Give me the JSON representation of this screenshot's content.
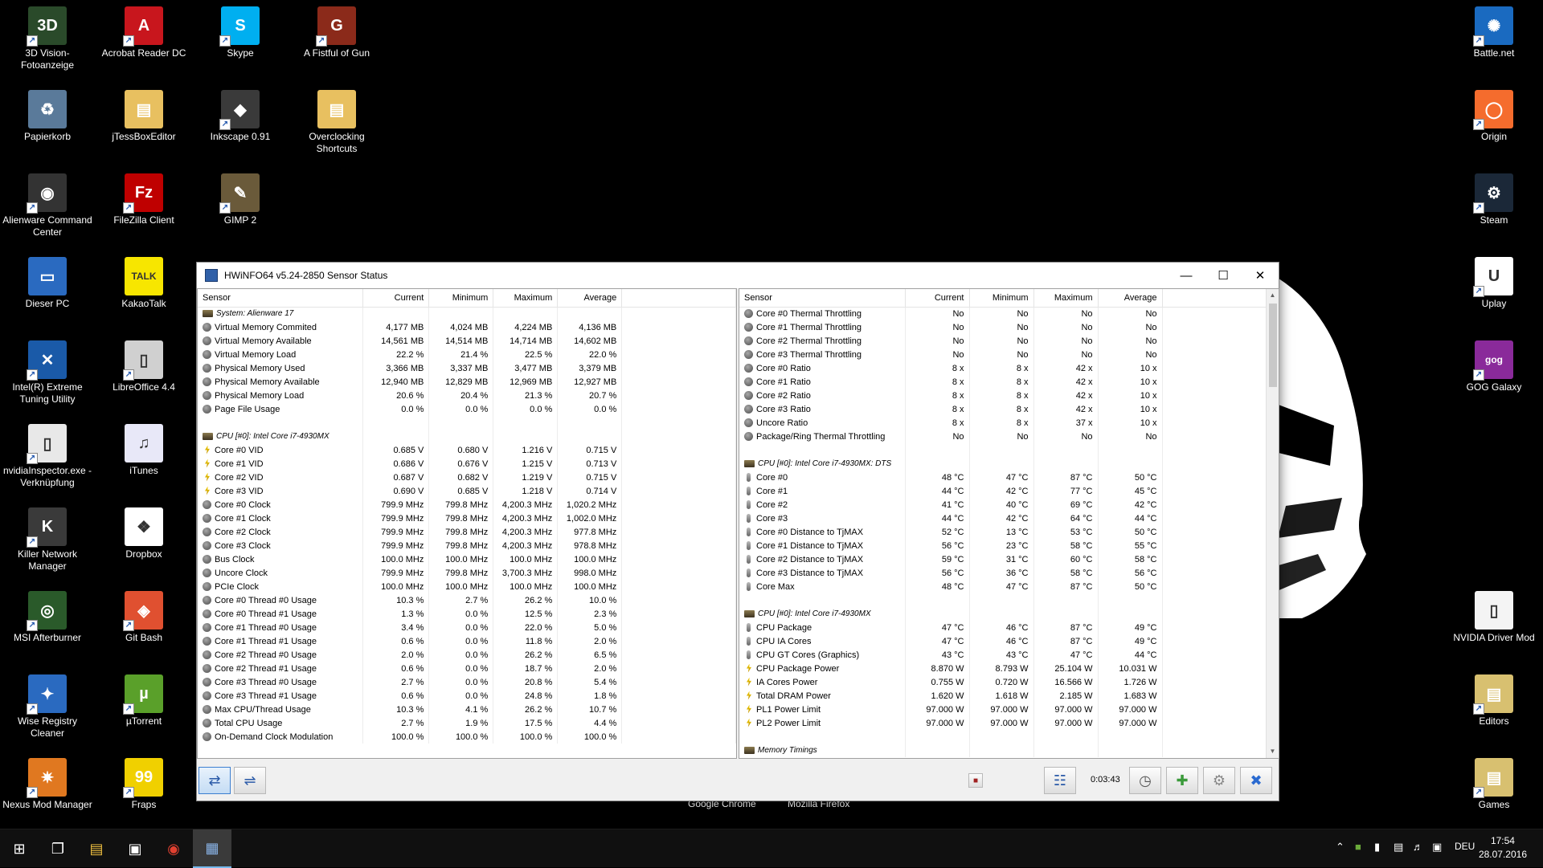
{
  "desktop_icons": [
    {
      "label": "3D Vision-Fotoanzeige",
      "bg": "#2a4a2a",
      "glyph": "3D",
      "shortcut": true
    },
    {
      "label": "Acrobat Reader DC",
      "bg": "#c8161d",
      "glyph": "A",
      "shortcut": true
    },
    {
      "label": "Skype",
      "bg": "#00aff0",
      "glyph": "S",
      "shortcut": true
    },
    {
      "label": "A Fistful of Gun",
      "bg": "#8b2a1a",
      "glyph": "G",
      "shortcut": true
    },
    {
      "label": "Papierkorb",
      "bg": "#5a7a9a",
      "glyph": "♻",
      "shortcut": false
    },
    {
      "label": "jTessBoxEditor",
      "bg": "#e8c060",
      "glyph": "▤",
      "shortcut": false
    },
    {
      "label": "Inkscape 0.91",
      "bg": "#3a3a3a",
      "glyph": "◆",
      "shortcut": true
    },
    {
      "label": "Overclocking Shortcuts",
      "bg": "#e8c060",
      "glyph": "▤",
      "shortcut": false
    },
    {
      "label": "Alienware Command Center",
      "bg": "#333",
      "glyph": "◉",
      "shortcut": true
    },
    {
      "label": "FileZilla Client",
      "bg": "#bf0000",
      "glyph": "Fz",
      "shortcut": true
    },
    {
      "label": "GIMP 2",
      "bg": "#6a5a3a",
      "glyph": "✎",
      "shortcut": true
    },
    {
      "label": "Dieser PC",
      "bg": "#2a6ac0",
      "glyph": "▭",
      "shortcut": false
    },
    {
      "label": "KakaoTalk",
      "bg": "#f7e600",
      "glyph": "TALK",
      "shortcut": false
    },
    {
      "label": "Intel(R) Extreme Tuning Utility",
      "bg": "#1a5aa8",
      "glyph": "✕",
      "shortcut": true
    },
    {
      "label": "LibreOffice 4.4",
      "bg": "#d0d0d0",
      "glyph": "▯",
      "shortcut": true
    },
    {
      "label": "nvidiaInspector.exe - Verknüpfung",
      "bg": "#e8e8e8",
      "glyph": "▯",
      "shortcut": true
    },
    {
      "label": "iTunes",
      "bg": "#e8e8f8",
      "glyph": "♫",
      "shortcut": false
    },
    {
      "label": "Killer Network Manager",
      "bg": "#3a3a3a",
      "glyph": "K",
      "shortcut": true
    },
    {
      "label": "Dropbox",
      "bg": "#ffffff",
      "glyph": "❖",
      "shortcut": false
    },
    {
      "label": "MSI Afterburner",
      "bg": "#2a5a2a",
      "glyph": "◎",
      "shortcut": true
    },
    {
      "label": "Git Bash",
      "bg": "#e05030",
      "glyph": "◈",
      "shortcut": true
    },
    {
      "label": "Wise Registry Cleaner",
      "bg": "#2a6ac0",
      "glyph": "✦",
      "shortcut": true
    },
    {
      "label": "µTorrent",
      "bg": "#5aa02a",
      "glyph": "µ",
      "shortcut": true
    },
    {
      "label": "Nexus Mod Manager",
      "bg": "#e07820",
      "glyph": "✷",
      "shortcut": true
    },
    {
      "label": "Fraps",
      "bg": "#f0d000",
      "glyph": "99",
      "shortcut": true
    },
    {
      "label": "Battle.net",
      "bg": "#1a6ac0",
      "glyph": "✺",
      "shortcut": true
    },
    {
      "label": "Origin",
      "bg": "#f56c2d",
      "glyph": "◯",
      "shortcut": true
    },
    {
      "label": "Steam",
      "bg": "#1b2838",
      "glyph": "⚙",
      "shortcut": true
    },
    {
      "label": "Uplay",
      "bg": "#ffffff",
      "glyph": "U",
      "shortcut": true
    },
    {
      "label": "GOG Galaxy",
      "bg": "#8a2a9a",
      "glyph": "gog",
      "shortcut": true
    },
    {
      "label": "NVIDIA Driver Mod",
      "bg": "#f4f4f4",
      "glyph": "▯",
      "shortcut": false
    },
    {
      "label": "Editors",
      "bg": "#d8c070",
      "glyph": "▤",
      "shortcut": true
    },
    {
      "label": "Games",
      "bg": "#d8c070",
      "glyph": "▤",
      "shortcut": true
    }
  ],
  "hidden_labels": [
    "Google Chrome",
    "Mozilla Firefox"
  ],
  "window": {
    "title": "HWiNFO64 v5.24-2850 Sensor Status",
    "timer": "0:03:43"
  },
  "columns": {
    "sensor": "Sensor",
    "current": "Current",
    "minimum": "Minimum",
    "maximum": "Maximum",
    "average": "Average"
  },
  "left_rows": [
    {
      "type": "group",
      "name": "System: Alienware 17"
    },
    {
      "icon": "circle",
      "name": "Virtual Memory Commited",
      "cur": "4,177 MB",
      "min": "4,024 MB",
      "max": "4,224 MB",
      "avg": "4,136 MB"
    },
    {
      "icon": "circle",
      "name": "Virtual Memory Available",
      "cur": "14,561 MB",
      "min": "14,514 MB",
      "max": "14,714 MB",
      "avg": "14,602 MB"
    },
    {
      "icon": "circle",
      "name": "Virtual Memory Load",
      "cur": "22.2 %",
      "min": "21.4 %",
      "max": "22.5 %",
      "avg": "22.0 %"
    },
    {
      "icon": "circle",
      "name": "Physical Memory Used",
      "cur": "3,366 MB",
      "min": "3,337 MB",
      "max": "3,477 MB",
      "avg": "3,379 MB"
    },
    {
      "icon": "circle",
      "name": "Physical Memory Available",
      "cur": "12,940 MB",
      "min": "12,829 MB",
      "max": "12,969 MB",
      "avg": "12,927 MB"
    },
    {
      "icon": "circle",
      "name": "Physical Memory Load",
      "cur": "20.6 %",
      "min": "20.4 %",
      "max": "21.3 %",
      "avg": "20.7 %"
    },
    {
      "icon": "circle",
      "name": "Page File Usage",
      "cur": "0.0 %",
      "min": "0.0 %",
      "max": "0.0 %",
      "avg": "0.0 %"
    },
    {
      "type": "blank"
    },
    {
      "type": "group",
      "name": "CPU [#0]: Intel Core i7-4930MX"
    },
    {
      "icon": "volt",
      "name": "Core #0 VID",
      "cur": "0.685 V",
      "min": "0.680 V",
      "max": "1.216 V",
      "avg": "0.715 V"
    },
    {
      "icon": "volt",
      "name": "Core #1 VID",
      "cur": "0.686 V",
      "min": "0.676 V",
      "max": "1.215 V",
      "avg": "0.713 V"
    },
    {
      "icon": "volt",
      "name": "Core #2 VID",
      "cur": "0.687 V",
      "min": "0.682 V",
      "max": "1.219 V",
      "avg": "0.715 V"
    },
    {
      "icon": "volt",
      "name": "Core #3 VID",
      "cur": "0.690 V",
      "min": "0.685 V",
      "max": "1.218 V",
      "avg": "0.714 V"
    },
    {
      "icon": "circle",
      "name": "Core #0 Clock",
      "cur": "799.9 MHz",
      "min": "799.8 MHz",
      "max": "4,200.3 MHz",
      "avg": "1,020.2 MHz"
    },
    {
      "icon": "circle",
      "name": "Core #1 Clock",
      "cur": "799.9 MHz",
      "min": "799.8 MHz",
      "max": "4,200.3 MHz",
      "avg": "1,002.0 MHz"
    },
    {
      "icon": "circle",
      "name": "Core #2 Clock",
      "cur": "799.9 MHz",
      "min": "799.8 MHz",
      "max": "4,200.3 MHz",
      "avg": "977.8 MHz"
    },
    {
      "icon": "circle",
      "name": "Core #3 Clock",
      "cur": "799.9 MHz",
      "min": "799.8 MHz",
      "max": "4,200.3 MHz",
      "avg": "978.8 MHz"
    },
    {
      "icon": "circle",
      "name": "Bus Clock",
      "cur": "100.0 MHz",
      "min": "100.0 MHz",
      "max": "100.0 MHz",
      "avg": "100.0 MHz"
    },
    {
      "icon": "circle",
      "name": "Uncore Clock",
      "cur": "799.9 MHz",
      "min": "799.8 MHz",
      "max": "3,700.3 MHz",
      "avg": "998.0 MHz"
    },
    {
      "icon": "circle",
      "name": "PCIe Clock",
      "cur": "100.0 MHz",
      "min": "100.0 MHz",
      "max": "100.0 MHz",
      "avg": "100.0 MHz"
    },
    {
      "icon": "circle",
      "name": "Core #0 Thread #0 Usage",
      "cur": "10.3 %",
      "min": "2.7 %",
      "max": "26.2 %",
      "avg": "10.0 %"
    },
    {
      "icon": "circle",
      "name": "Core #0 Thread #1 Usage",
      "cur": "1.3 %",
      "min": "0.0 %",
      "max": "12.5 %",
      "avg": "2.3 %"
    },
    {
      "icon": "circle",
      "name": "Core #1 Thread #0 Usage",
      "cur": "3.4 %",
      "min": "0.0 %",
      "max": "22.0 %",
      "avg": "5.0 %"
    },
    {
      "icon": "circle",
      "name": "Core #1 Thread #1 Usage",
      "cur": "0.6 %",
      "min": "0.0 %",
      "max": "11.8 %",
      "avg": "2.0 %"
    },
    {
      "icon": "circle",
      "name": "Core #2 Thread #0 Usage",
      "cur": "2.0 %",
      "min": "0.0 %",
      "max": "26.2 %",
      "avg": "6.5 %"
    },
    {
      "icon": "circle",
      "name": "Core #2 Thread #1 Usage",
      "cur": "0.6 %",
      "min": "0.0 %",
      "max": "18.7 %",
      "avg": "2.0 %"
    },
    {
      "icon": "circle",
      "name": "Core #3 Thread #0 Usage",
      "cur": "2.7 %",
      "min": "0.0 %",
      "max": "20.8 %",
      "avg": "5.4 %"
    },
    {
      "icon": "circle",
      "name": "Core #3 Thread #1 Usage",
      "cur": "0.6 %",
      "min": "0.0 %",
      "max": "24.8 %",
      "avg": "1.8 %"
    },
    {
      "icon": "circle",
      "name": "Max CPU/Thread Usage",
      "cur": "10.3 %",
      "min": "4.1 %",
      "max": "26.2 %",
      "avg": "10.7 %"
    },
    {
      "icon": "circle",
      "name": "Total CPU Usage",
      "cur": "2.7 %",
      "min": "1.9 %",
      "max": "17.5 %",
      "avg": "4.4 %"
    },
    {
      "icon": "circle",
      "name": "On-Demand Clock Modulation",
      "cur": "100.0 %",
      "min": "100.0 %",
      "max": "100.0 %",
      "avg": "100.0 %"
    }
  ],
  "right_rows": [
    {
      "icon": "circle",
      "name": "Core #0 Thermal Throttling",
      "cur": "No",
      "min": "No",
      "max": "No",
      "avg": "No"
    },
    {
      "icon": "circle",
      "name": "Core #1 Thermal Throttling",
      "cur": "No",
      "min": "No",
      "max": "No",
      "avg": "No"
    },
    {
      "icon": "circle",
      "name": "Core #2 Thermal Throttling",
      "cur": "No",
      "min": "No",
      "max": "No",
      "avg": "No"
    },
    {
      "icon": "circle",
      "name": "Core #3 Thermal Throttling",
      "cur": "No",
      "min": "No",
      "max": "No",
      "avg": "No"
    },
    {
      "icon": "circle",
      "name": "Core #0 Ratio",
      "cur": "8 x",
      "min": "8 x",
      "max": "42 x",
      "avg": "10 x"
    },
    {
      "icon": "circle",
      "name": "Core #1 Ratio",
      "cur": "8 x",
      "min": "8 x",
      "max": "42 x",
      "avg": "10 x"
    },
    {
      "icon": "circle",
      "name": "Core #2 Ratio",
      "cur": "8 x",
      "min": "8 x",
      "max": "42 x",
      "avg": "10 x"
    },
    {
      "icon": "circle",
      "name": "Core #3 Ratio",
      "cur": "8 x",
      "min": "8 x",
      "max": "42 x",
      "avg": "10 x"
    },
    {
      "icon": "circle",
      "name": "Uncore Ratio",
      "cur": "8 x",
      "min": "8 x",
      "max": "37 x",
      "avg": "10 x"
    },
    {
      "icon": "circle",
      "name": "Package/Ring Thermal Throttling",
      "cur": "No",
      "min": "No",
      "max": "No",
      "avg": "No"
    },
    {
      "type": "blank"
    },
    {
      "type": "group",
      "name": "CPU [#0]: Intel Core i7-4930MX: DTS"
    },
    {
      "icon": "temp",
      "name": "Core #0",
      "cur": "48 °C",
      "min": "47 °C",
      "max": "87 °C",
      "avg": "50 °C"
    },
    {
      "icon": "temp",
      "name": "Core #1",
      "cur": "44 °C",
      "min": "42 °C",
      "max": "77 °C",
      "avg": "45 °C"
    },
    {
      "icon": "temp",
      "name": "Core #2",
      "cur": "41 °C",
      "min": "40 °C",
      "max": "69 °C",
      "avg": "42 °C"
    },
    {
      "icon": "temp",
      "name": "Core #3",
      "cur": "44 °C",
      "min": "42 °C",
      "max": "64 °C",
      "avg": "44 °C"
    },
    {
      "icon": "temp",
      "name": "Core #0 Distance to TjMAX",
      "cur": "52 °C",
      "min": "13 °C",
      "max": "53 °C",
      "avg": "50 °C"
    },
    {
      "icon": "temp",
      "name": "Core #1 Distance to TjMAX",
      "cur": "56 °C",
      "min": "23 °C",
      "max": "58 °C",
      "avg": "55 °C"
    },
    {
      "icon": "temp",
      "name": "Core #2 Distance to TjMAX",
      "cur": "59 °C",
      "min": "31 °C",
      "max": "60 °C",
      "avg": "58 °C"
    },
    {
      "icon": "temp",
      "name": "Core #3 Distance to TjMAX",
      "cur": "56 °C",
      "min": "36 °C",
      "max": "58 °C",
      "avg": "56 °C"
    },
    {
      "icon": "temp",
      "name": "Core Max",
      "cur": "48 °C",
      "min": "47 °C",
      "max": "87 °C",
      "avg": "50 °C"
    },
    {
      "type": "blank"
    },
    {
      "type": "group",
      "name": "CPU [#0]: Intel Core i7-4930MX"
    },
    {
      "icon": "temp",
      "name": "CPU Package",
      "cur": "47 °C",
      "min": "46 °C",
      "max": "87 °C",
      "avg": "49 °C"
    },
    {
      "icon": "temp",
      "name": "CPU IA Cores",
      "cur": "47 °C",
      "min": "46 °C",
      "max": "87 °C",
      "avg": "49 °C"
    },
    {
      "icon": "temp",
      "name": "CPU GT Cores (Graphics)",
      "cur": "43 °C",
      "min": "43 °C",
      "max": "47 °C",
      "avg": "44 °C"
    },
    {
      "icon": "volt",
      "name": "CPU Package Power",
      "cur": "8.870 W",
      "min": "8.793 W",
      "max": "25.104 W",
      "avg": "10.031 W"
    },
    {
      "icon": "volt",
      "name": "IA Cores Power",
      "cur": "0.755 W",
      "min": "0.720 W",
      "max": "16.566 W",
      "avg": "1.726 W"
    },
    {
      "icon": "volt",
      "name": "Total DRAM Power",
      "cur": "1.620 W",
      "min": "1.618 W",
      "max": "2.185 W",
      "avg": "1.683 W"
    },
    {
      "icon": "volt",
      "name": "PL1 Power Limit",
      "cur": "97.000 W",
      "min": "97.000 W",
      "max": "97.000 W",
      "avg": "97.000 W"
    },
    {
      "icon": "volt",
      "name": "PL2 Power Limit",
      "cur": "97.000 W",
      "min": "97.000 W",
      "max": "97.000 W",
      "avg": "97.000 W"
    },
    {
      "type": "blank"
    },
    {
      "type": "group",
      "name": "Memory Timings"
    }
  ],
  "taskbar": {
    "lang": "DEU",
    "time": "17:54",
    "date": "28.07.2016"
  }
}
